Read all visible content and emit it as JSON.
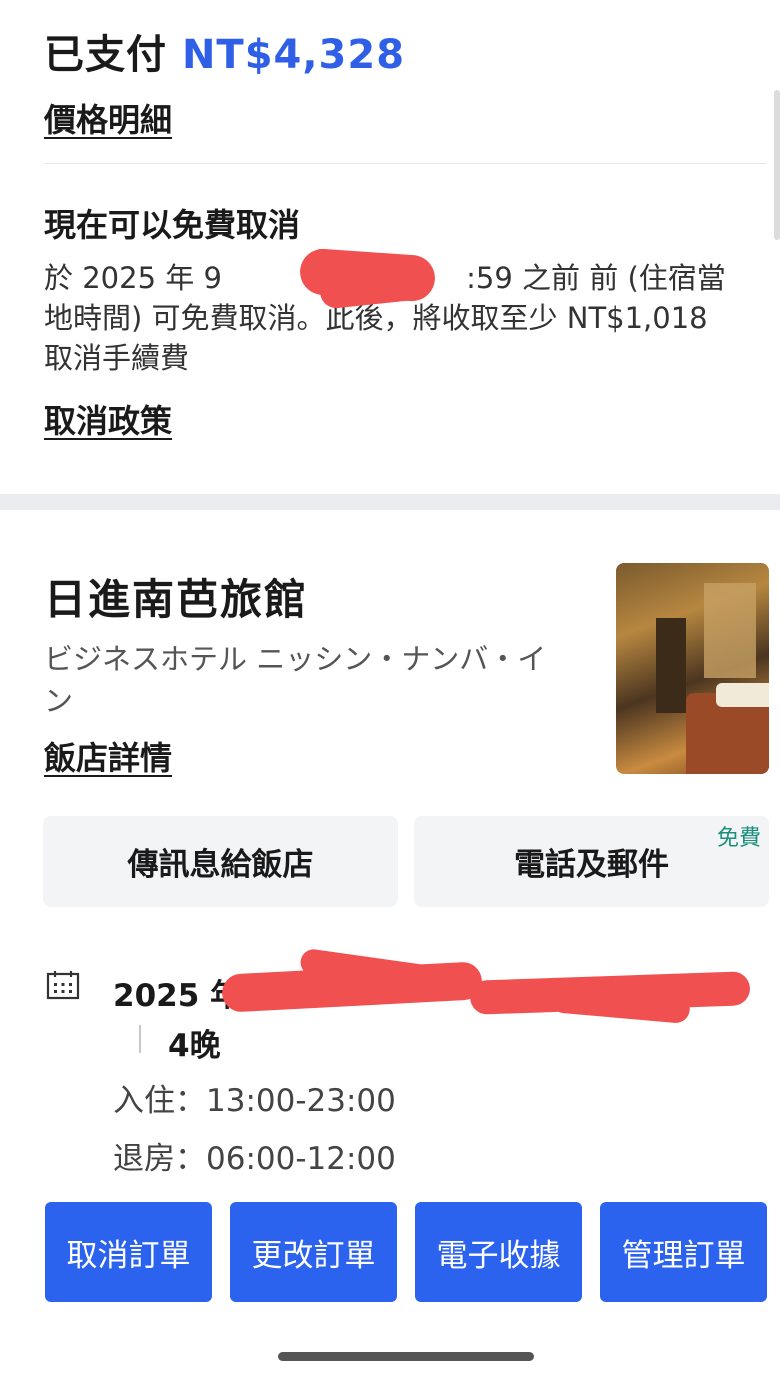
{
  "payment": {
    "label": "已支付",
    "amount": "NT$4,328",
    "details_link": "價格明細"
  },
  "cancellation": {
    "title": "現在可以免費取消",
    "body_start": "於 2025 年 9 ",
    "body_end": ":59 之前 前 (住宿當地時間) 可免費取消。此後，將收取至少 NT$1,018 取消手續費",
    "policy_link": "取消政策"
  },
  "hotel": {
    "name": "日進南芭旅館",
    "name_local": "ビジネスホテル ニッシン・ナンバ・イン",
    "details_link": "飯店詳情"
  },
  "actions": {
    "message": "傳訊息給飯店",
    "phone": "電話及郵件",
    "free_badge": "免費"
  },
  "stay": {
    "dates_prefix": "2025 年",
    "nights": "4晚",
    "checkin": "入住：13:00-23:00",
    "checkout": "退房：06:00-12:00"
  },
  "buttons": {
    "cancel": "取消訂單",
    "modify": "更改訂單",
    "receipt": "電子收據",
    "manage": "管理訂單"
  },
  "colors": {
    "accent": "#2c63ee",
    "amount": "#2f5fe6",
    "free_badge": "#1a8f7b",
    "redaction": "#f0504f"
  },
  "icons": {
    "dates": "calendar-icon"
  }
}
